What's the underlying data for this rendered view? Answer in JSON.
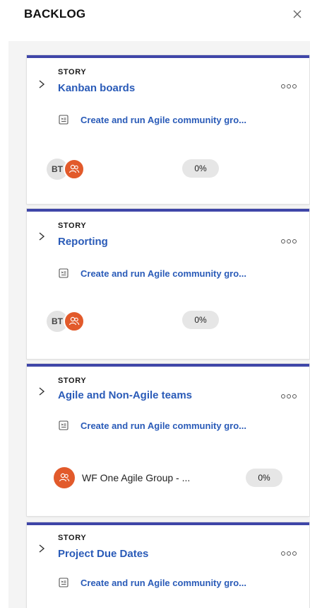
{
  "panel": {
    "title": "BACKLOG",
    "close_icon": "close-icon"
  },
  "colors": {
    "card_accent": "#3f46a8",
    "link": "#2a5bb8",
    "team_avatar": "#e25a2b",
    "pill": "#e6e6e6",
    "area_bg": "#f4f4f4"
  },
  "cards": [
    {
      "type": "STORY",
      "title": "Kanban boards",
      "parent": "Create and run Agile community gro...",
      "assignee_initials": "BT",
      "progress": "0%"
    },
    {
      "type": "STORY",
      "title": "Reporting",
      "parent": "Create and run Agile community gro...",
      "assignee_initials": "BT",
      "progress": "0%"
    },
    {
      "type": "STORY",
      "title": "Agile and Non-Agile teams",
      "parent": "Create and run Agile community gro...",
      "team_name": "WF One Agile Group - ...",
      "progress": "0%"
    },
    {
      "type": "STORY",
      "title": "Project Due Dates",
      "parent": "Create and run Agile community gro..."
    }
  ]
}
